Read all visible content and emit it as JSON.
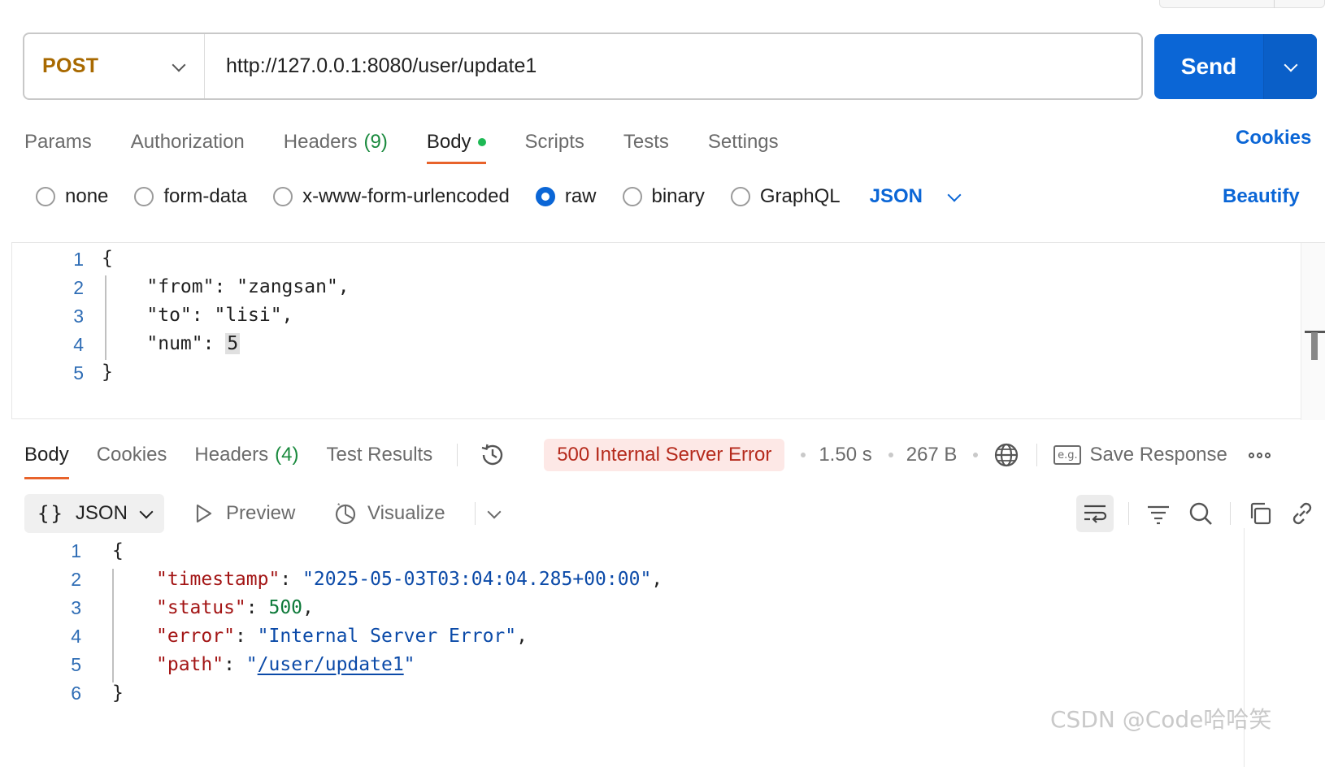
{
  "request": {
    "method": "POST",
    "url": "http://127.0.0.1:8080/user/update1",
    "send_label": "Send"
  },
  "request_tabs": [
    {
      "label": "Params"
    },
    {
      "label": "Authorization"
    },
    {
      "label": "Headers",
      "count": "(9)"
    },
    {
      "label": "Body",
      "active": true
    },
    {
      "label": "Scripts"
    },
    {
      "label": "Tests"
    },
    {
      "label": "Settings"
    }
  ],
  "cookies_label": "Cookies",
  "body_types": {
    "options": [
      "none",
      "form-data",
      "x-www-form-urlencoded",
      "raw",
      "binary",
      "GraphQL"
    ],
    "selected": "raw",
    "format": "JSON",
    "beautify_label": "Beautify"
  },
  "request_body": {
    "line_numbers": [
      "1",
      "2",
      "3",
      "4",
      "5"
    ],
    "lines": [
      "{",
      "    \"from\": \"zangsan\",",
      "    \"to\": \"lisi\",",
      "    \"num\": ",
      "}"
    ],
    "num_value": "5"
  },
  "response_tabs": [
    {
      "label": "Body",
      "active": true
    },
    {
      "label": "Cookies"
    },
    {
      "label": "Headers",
      "count": "(4)"
    },
    {
      "label": "Test Results"
    }
  ],
  "response_meta": {
    "status": "500 Internal Server Error",
    "status_color": "#b52a1c",
    "time": "1.50 s",
    "size": "267 B",
    "save_label": "Save Response",
    "eg_label": "e.g."
  },
  "response_toolbar": {
    "format_braces": "{}",
    "format": "JSON",
    "preview_label": "Preview",
    "visualize_label": "Visualize"
  },
  "response_body": {
    "line_numbers": [
      "1",
      "2",
      "3",
      "4",
      "5",
      "6"
    ],
    "open": "{",
    "close": "}",
    "timestamp_key": "\"timestamp\"",
    "timestamp_val": "\"2025-05-03T03:04:04.285+00:00\"",
    "status_key": "\"status\"",
    "status_val": "500",
    "error_key": "\"error\"",
    "error_val": "\"Internal Server Error\"",
    "path_key": "\"path\"",
    "path_val": "/user/update1"
  },
  "watermark": "CSDN @Code哈哈笑",
  "colors": {
    "accent": "#0b66d6",
    "active_tab_underline": "#e8632b",
    "method": "#a86900",
    "error_badge_bg": "#fde8e6"
  }
}
